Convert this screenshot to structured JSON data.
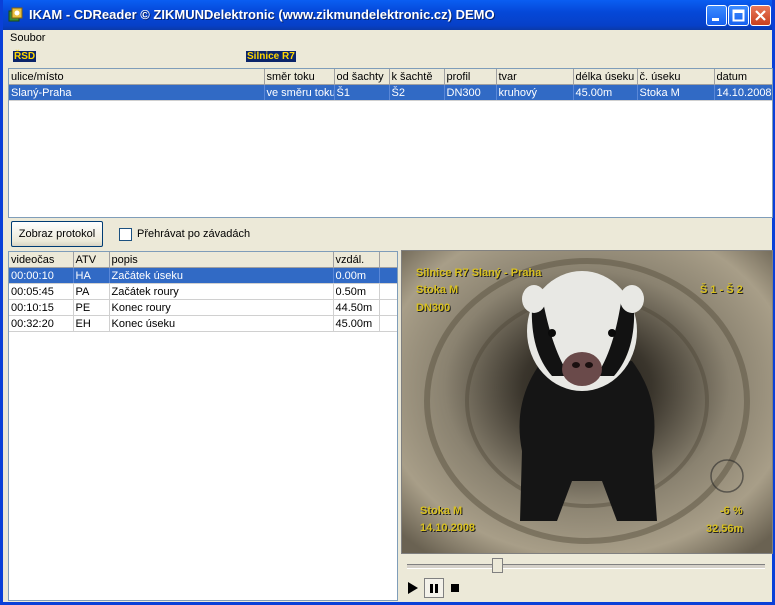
{
  "window": {
    "title": "IKAM - CDReader    © ZIKMUNDelektronic (www.zikmundelektronic.cz)  DEMO"
  },
  "menu": {
    "file": "Soubor"
  },
  "info": {
    "left": "ŘSD",
    "right": "Silnice R7"
  },
  "sections": {
    "columns": [
      "ulice/místo",
      "směr toku",
      "od šachty",
      "k šachtě",
      "profil",
      "tvar",
      "délka úseku",
      "č. úseku",
      "datum"
    ],
    "rows": [
      [
        "Slaný-Praha",
        "ve směru toku",
        "Š1",
        "Š2",
        "DN300",
        "kruhový",
        "45.00m",
        "Stoka M",
        "14.10.2008"
      ]
    ]
  },
  "toolbar": {
    "protocol_button": "Zobraz protokol",
    "defects_checkbox": "Přehrávat po závadách",
    "defects_checked": false
  },
  "events": {
    "columns": [
      "videočas",
      "ATV",
      "popis",
      "vzdál."
    ],
    "rows": [
      [
        "00:00:10",
        "HA",
        "Začátek úseku",
        "0.00m"
      ],
      [
        "00:05:45",
        "PA",
        "Začátek roury",
        "0.50m"
      ],
      [
        "00:10:15",
        "PE",
        "Konec roury",
        "44.50m"
      ],
      [
        "00:32:20",
        "EH",
        "Konec úseku",
        "45.00m"
      ]
    ]
  },
  "video": {
    "osd_line1": "Silnice R7 Slaný - Praha",
    "osd_line2": "Stoka M",
    "osd_line3": "DN300",
    "osd_section": "Š 1 - Š 2",
    "osd_bottom_left1": "Stoka M",
    "osd_bottom_left2": "14.10.2008",
    "osd_slope": "-6 %",
    "osd_distance": "32.56m"
  },
  "playback": {
    "position": 0.25
  },
  "colors": {
    "selection": "#316ac5",
    "titlebar": "#0548d8",
    "osd": "#d8c020"
  }
}
